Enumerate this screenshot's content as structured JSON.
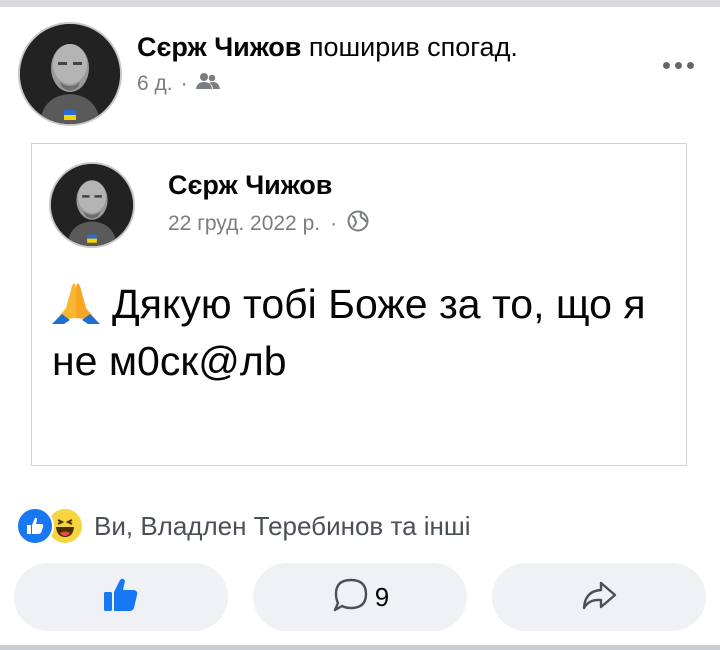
{
  "post": {
    "author": "Сєрж Чижов",
    "action": "поширив спогад.",
    "time": "6 д.",
    "separator": "·",
    "audience_icon": "friends-icon"
  },
  "memory": {
    "author": "Сєрж Чижов",
    "date": "22 груд. 2022 р.",
    "separator": "·",
    "audience_icon": "globe-icon",
    "emoji": "folded-hands-icon",
    "text": "Дякую тобі Боже за то, що я не м0ск@лb"
  },
  "reactions": {
    "icons": [
      "like-icon",
      "haha-icon"
    ],
    "summary": "Ви, Владлен Теребинов та інші"
  },
  "actions": {
    "like_icon": "thumbs-up-icon",
    "comment_icon": "comment-icon",
    "comment_count": "9",
    "share_icon": "share-icon"
  },
  "colors": {
    "accent": "#1877f2",
    "muted_text": "#7a7d82",
    "button_bg": "#eff1f4",
    "card_border": "#cfd2d6"
  }
}
